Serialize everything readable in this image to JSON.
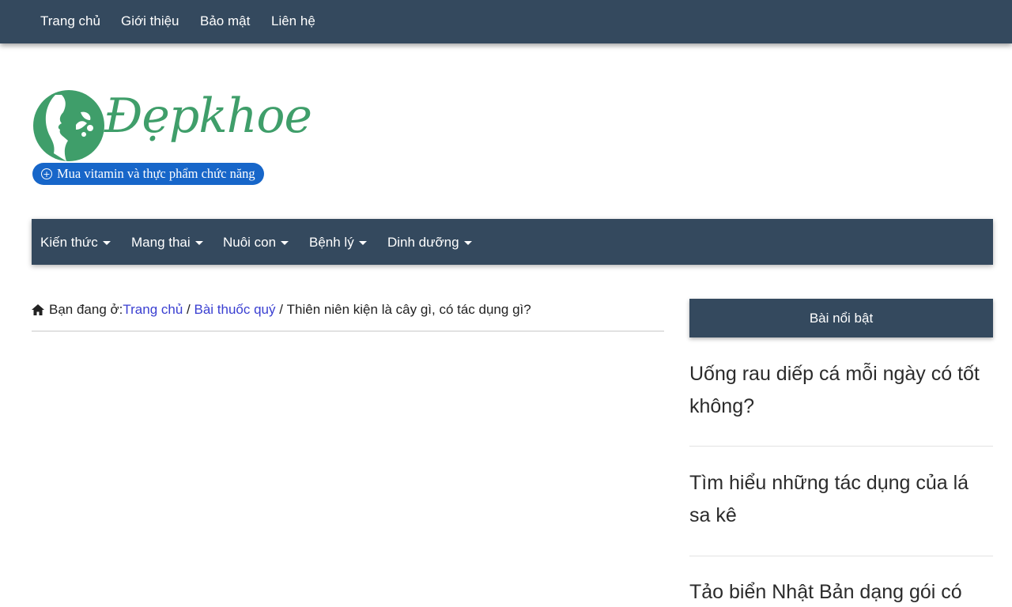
{
  "top_nav": [
    "Trang chủ",
    "Giới thiệu",
    "Bảo mật",
    "Liên hệ"
  ],
  "logo": {
    "text": "Đẹpkhoe",
    "button": "Mua vitamin và thực phẩm chức năng"
  },
  "main_nav": [
    "Kiến thức",
    "Mang thai",
    "Nuôi con",
    "Bệnh lý",
    "Dinh dưỡng"
  ],
  "breadcrumb": {
    "prefix": "Bạn đang ở:",
    "home": "Trang chủ",
    "sep1": " / ",
    "category": "Bài thuốc quý",
    "sep2": " / ",
    "current": "Thiên niên kiện là cây gì, có tác dụng gì?"
  },
  "sidebar": {
    "title": "Bài nổi bật",
    "posts": [
      {
        "line1": "Uống rau diếp cá mỗi ngày có tốt",
        "line2": "không?"
      },
      {
        "line1": "Tìm hiểu những tác dụng của lá",
        "line2": "sa kê"
      },
      {
        "line1": "Tảo biển Nhật Bản dạng gói có",
        "line2": ""
      }
    ]
  },
  "colors": {
    "nav_bg": "#34495e",
    "link": "#3a3fd1",
    "brand_green": "#3f9e6a",
    "button_blue": "#1766c9"
  }
}
